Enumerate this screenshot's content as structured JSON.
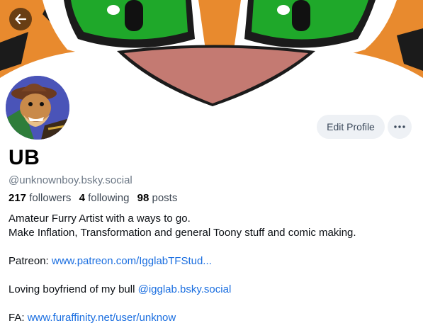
{
  "profile": {
    "display_name": "UB",
    "handle": "@unknownboy.bsky.social",
    "stats": {
      "followers_count": "217",
      "followers_label": "followers",
      "following_count": "4",
      "following_label": "following",
      "posts_count": "98",
      "posts_label": "posts"
    },
    "actions": {
      "edit_profile_label": "Edit Profile",
      "more_icon": "ellipsis-icon"
    },
    "bio": {
      "line1": "Amateur Furry Artist with a ways to go.",
      "line2": "Make Inflation, Transformation and general Toony stuff and comic making.",
      "patreon_label": "Patreon: ",
      "patreon_link": "www.patreon.com/IgglabTFStud...",
      "boyfriend_text": "Loving boyfriend of my bull ",
      "boyfriend_mention": "@igglab.bsky.social",
      "fa_label": "FA: ",
      "fa_link": "www.furaffinity.net/user/unknow"
    }
  },
  "navigation": {
    "back_icon": "arrow-left-icon"
  },
  "colors": {
    "link": "#1a6ee0",
    "handle_gray": "#6b7785",
    "button_bg": "#eef1f5",
    "banner_orange": "#e88a2e",
    "banner_eye_green": "#1fa82a",
    "banner_nose": "#c47a72",
    "avatar_bg": "#4a54b8"
  }
}
